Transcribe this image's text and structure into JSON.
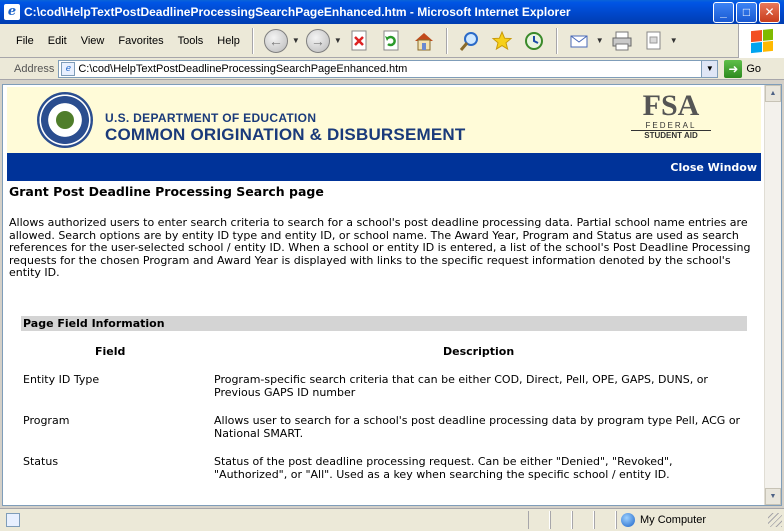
{
  "window": {
    "title": "C:\\cod\\HelpTextPostDeadlineProcessingSearchPageEnhanced.htm - Microsoft Internet Explorer",
    "minimize": "_",
    "maximize": "□",
    "close": "✕"
  },
  "menu": {
    "file": "File",
    "edit": "Edit",
    "view": "View",
    "favorites": "Favorites",
    "tools": "Tools",
    "help": "Help"
  },
  "address": {
    "label": "Address",
    "url": "C:\\cod\\HelpTextPostDeadlineProcessingSearchPageEnhanced.htm",
    "go": "Go"
  },
  "header": {
    "dept": "U.S. DEPARTMENT OF EDUCATION",
    "cod": "COMMON ORIGINATION & DISBURSEMENT",
    "fsa_big": "FSA",
    "fsa_line1": "FEDERAL",
    "fsa_line2": "STUDENT AID",
    "close_window": "Close Window"
  },
  "content": {
    "title": "Grant Post Deadline Processing Search page",
    "description": "Allows authorized users to enter search criteria to search for a school's post deadline processing data. Partial school name entries are allowed. Search options are by entity ID type and entity ID, or school name. The Award Year, Program and Status are used as search references for the user-selected school / entity ID. When a school or entity ID is entered, a list of the school's Post Deadline Processing requests for the chosen Program and Award Year is displayed with links to the specific request information denoted by the school's entity ID.",
    "section_heading": "Page Field Information",
    "col_field": "Field",
    "col_description": "Description",
    "rows": [
      {
        "field": "Entity ID Type",
        "description": "Program-specific search criteria that can be either COD, Direct, Pell, OPE, GAPS, DUNS, or Previous GAPS ID number"
      },
      {
        "field": "Program",
        "description": "Allows user to search for a school's post deadline processing data by program type Pell, ACG or National SMART."
      },
      {
        "field": "Status",
        "description": "Status of the post deadline processing request. Can be either \"Denied\", \"Revoked\", \"Authorized\", or \"All\". Used as a key when searching the specific school / entity ID."
      }
    ]
  },
  "status": {
    "zone": "My Computer"
  },
  "icons": {
    "back": "back-arrow-icon",
    "forward": "forward-arrow-icon",
    "stop": "stop-icon",
    "refresh": "refresh-icon",
    "home": "home-icon",
    "search": "search-icon",
    "favorites": "favorites-star-icon",
    "history": "history-icon",
    "mail": "mail-icon",
    "print": "print-icon",
    "edit": "edit-page-icon"
  }
}
